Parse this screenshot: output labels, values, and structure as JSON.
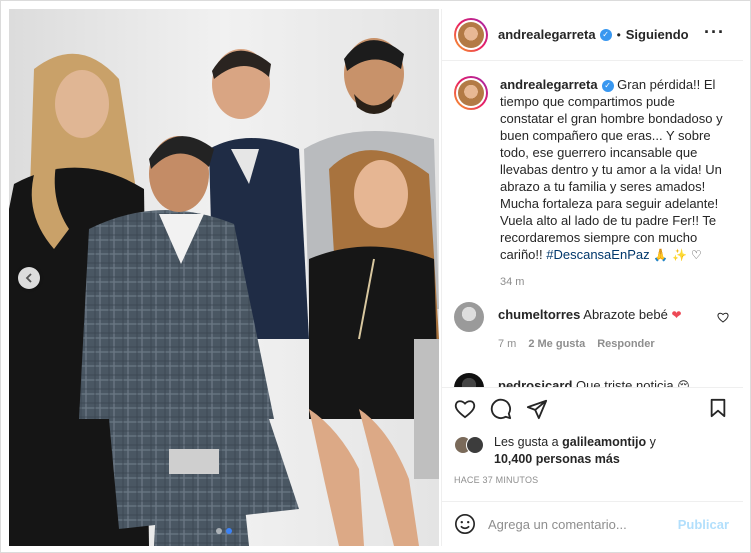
{
  "post": {
    "username": "andrealegarreta",
    "follow_status": "Siguiendo",
    "more_icon": "more-horizontal-icon",
    "carousel": {
      "current": 2,
      "total": 2
    }
  },
  "caption": {
    "username": "andrealegarreta",
    "text": " Gran pérdida!! El tiempo que compartimos pude constatar el gran hombre bondadoso y buen compañero que eras... Y sobre todo, ese guerrero incansable que llevabas dentro y tu amor a la vida! Un abrazo a tu familia y seres amados! Mucha fortaleza para seguir adelante! Vuela alto al lado de tu padre Fer!! Te recordaremos siempre con mucho cariño!! ",
    "hashtag": "#DescansaEnPaz",
    "emojis": " 🙏 ✨ ♡",
    "time": "34 m"
  },
  "comments": [
    {
      "username": "chumeltorres",
      "text": " Abrazote bebé ",
      "emoji": "❤",
      "time": "7 m",
      "likes": "2 Me gusta",
      "reply": "Responder"
    },
    {
      "username": "pedrosicard",
      "text": " Que triste noticia ",
      "emoji": "😔"
    }
  ],
  "likes": {
    "prefix": "Les gusta a ",
    "user": "galileamontijo",
    "suffix": " y",
    "count": "10,400 personas más"
  },
  "timestamp": "HACE 37 MINUTOS",
  "add_comment": {
    "placeholder": "Agrega un comentario...",
    "publish": "Publicar"
  },
  "colors": {
    "verified": "#3897f0",
    "hashtag": "#00376b",
    "publish_disabled": "#b2dffc",
    "heart_red": "#ed4956"
  }
}
